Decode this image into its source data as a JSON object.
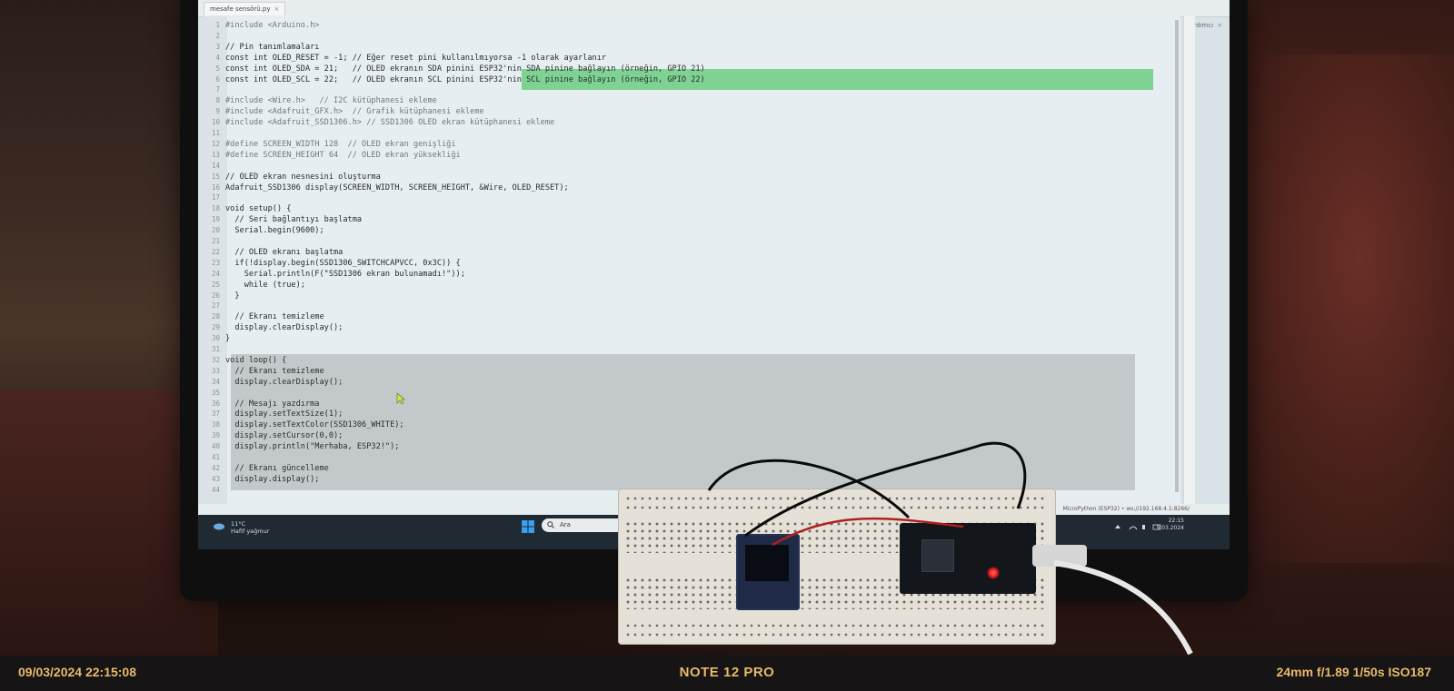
{
  "ide": {
    "tab_label": "mesafe sensörü.py",
    "help_label": "Yardımcı",
    "status_right": "MicroPython (ESP32) • ws://192.168.4.1:8266/"
  },
  "code_lines": [
    {
      "n": "1",
      "t": "#include <Arduino.h>",
      "c": "comment"
    },
    {
      "n": "2",
      "t": "",
      "c": ""
    },
    {
      "n": "3",
      "t": "// Pin tanımlamaları",
      "c": ""
    },
    {
      "n": "4",
      "t": "const int OLED_RESET = -1; // Eğer reset pini kullanılmıyorsa -1 olarak ayarlanır",
      "c": ""
    },
    {
      "n": "5",
      "t": "const int OLED_SDA = 21;   // OLED ekranın SDA pinini ESP32'nin SDA pinine bağlayın (örneğin, GPIO 21)",
      "c": ""
    },
    {
      "n": "6",
      "t": "const int OLED_SCL = 22;   // OLED ekranın SCL pinini ESP32'nin SCL pinine bağlayın (örneğin, GPIO 22)",
      "c": ""
    },
    {
      "n": "7",
      "t": "",
      "c": ""
    },
    {
      "n": "8",
      "t": "#include <Wire.h>   // I2C kütüphanesi ekleme",
      "c": "comment"
    },
    {
      "n": "9",
      "t": "#include <Adafruit_GFX.h>  // Grafik kütüphanesi ekleme",
      "c": "comment"
    },
    {
      "n": "10",
      "t": "#include <Adafruit_SSD1306.h> // SSD1306 OLED ekran kütüphanesi ekleme",
      "c": "comment"
    },
    {
      "n": "11",
      "t": "",
      "c": ""
    },
    {
      "n": "12",
      "t": "#define SCREEN_WIDTH 128  // OLED ekran genişliği",
      "c": "comment"
    },
    {
      "n": "13",
      "t": "#define SCREEN_HEIGHT 64  // OLED ekran yüksekliği",
      "c": "comment"
    },
    {
      "n": "14",
      "t": "",
      "c": ""
    },
    {
      "n": "15",
      "t": "// OLED ekran nesnesini oluşturma",
      "c": ""
    },
    {
      "n": "16",
      "t": "Adafruit_SSD1306 display(SCREEN_WIDTH, SCREEN_HEIGHT, &Wire, OLED_RESET);",
      "c": ""
    },
    {
      "n": "17",
      "t": "",
      "c": ""
    },
    {
      "n": "18",
      "t": "void setup() {",
      "c": ""
    },
    {
      "n": "19",
      "t": "  // Seri bağlantıyı başlatma",
      "c": ""
    },
    {
      "n": "20",
      "t": "  Serial.begin(9600);",
      "c": ""
    },
    {
      "n": "21",
      "t": "",
      "c": ""
    },
    {
      "n": "22",
      "t": "  // OLED ekranı başlatma",
      "c": ""
    },
    {
      "n": "23",
      "t": "  if(!display.begin(SSD1306_SWITCHCAPVCC, 0x3C)) {",
      "c": ""
    },
    {
      "n": "24",
      "t": "    Serial.println(F(\"SSD1306 ekran bulunamadı!\"));",
      "c": ""
    },
    {
      "n": "25",
      "t": "    while (true);",
      "c": ""
    },
    {
      "n": "26",
      "t": "  }",
      "c": ""
    },
    {
      "n": "27",
      "t": "",
      "c": ""
    },
    {
      "n": "28",
      "t": "  // Ekranı temizleme",
      "c": ""
    },
    {
      "n": "29",
      "t": "  display.clearDisplay();",
      "c": ""
    },
    {
      "n": "30",
      "t": "}",
      "c": ""
    },
    {
      "n": "31",
      "t": "",
      "c": ""
    },
    {
      "n": "32",
      "t": "void loop() {",
      "c": ""
    },
    {
      "n": "33",
      "t": "  // Ekranı temizleme",
      "c": ""
    },
    {
      "n": "34",
      "t": "  display.clearDisplay();",
      "c": ""
    },
    {
      "n": "35",
      "t": "",
      "c": ""
    },
    {
      "n": "36",
      "t": "  // Mesajı yazdırma",
      "c": ""
    },
    {
      "n": "37",
      "t": "  display.setTextSize(1);",
      "c": ""
    },
    {
      "n": "38",
      "t": "  display.setTextColor(SSD1306_WHITE);",
      "c": ""
    },
    {
      "n": "39",
      "t": "  display.setCursor(0,0);",
      "c": ""
    },
    {
      "n": "40",
      "t": "  display.println(\"Merhaba, ESP32!\");",
      "c": ""
    },
    {
      "n": "41",
      "t": "",
      "c": ""
    },
    {
      "n": "42",
      "t": "  // Ekranı güncelleme",
      "c": ""
    },
    {
      "n": "43",
      "t": "  display.display();",
      "c": ""
    },
    {
      "n": "44",
      "t": "",
      "c": ""
    }
  ],
  "taskbar": {
    "weather_temp": "11°C",
    "weather_desc": "Hafif yağmur",
    "search_placeholder": "Ara",
    "time": "22:15",
    "date": "9.03.2024"
  },
  "camera_info": {
    "datetime": "09/03/2024  22:15:08",
    "model": "NOTE 12 PRO",
    "settings": "24mm  f/1.89  1/50s  ISO187"
  }
}
